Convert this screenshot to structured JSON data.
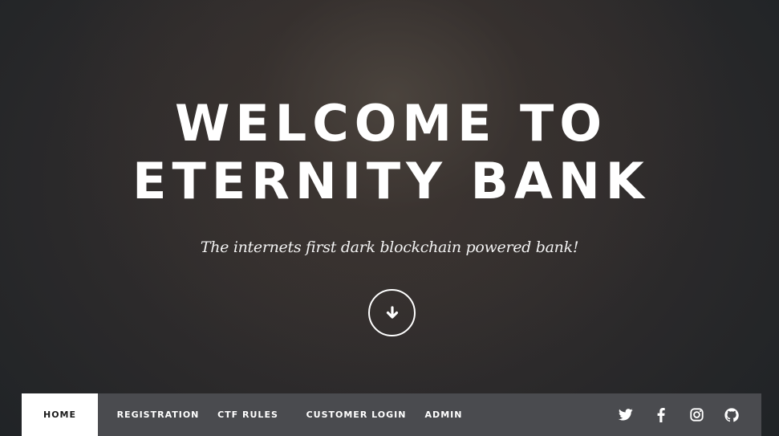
{
  "hero": {
    "title_line1": "WELCOME TO",
    "title_line2": "ETERNITY BANK",
    "subtitle": "The internets first dark blockchain powered bank!",
    "scroll_icon": "arrow-down-icon"
  },
  "nav": {
    "items": [
      {
        "label": "HOME",
        "active": true
      },
      {
        "label": "REGISTRATION"
      },
      {
        "label": "CTF RULES"
      },
      {
        "label": "CUSTOMER LOGIN"
      },
      {
        "label": "ADMIN"
      }
    ],
    "social_icons": [
      "twitter-icon",
      "facebook-icon",
      "instagram-icon",
      "github-icon"
    ]
  },
  "colors": {
    "nav_background": "#4a4b4f",
    "nav_active_background": "#ffffff",
    "text": "#ffffff"
  }
}
